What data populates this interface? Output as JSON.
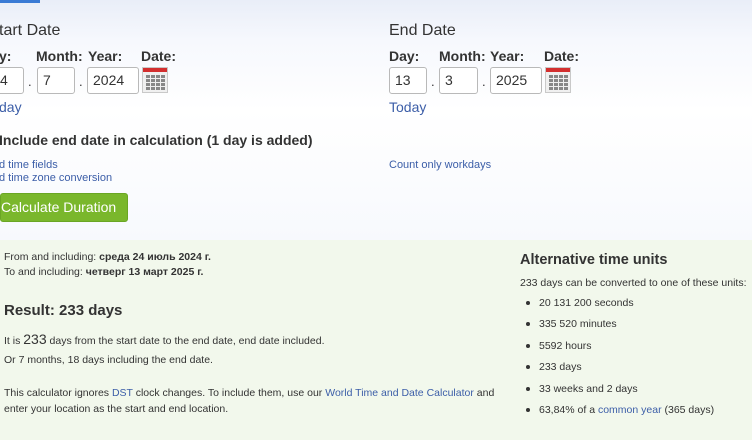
{
  "start": {
    "heading": "tart Date",
    "day_label": "y:",
    "month_label": "Month:",
    "year_label": "Year:",
    "date_label": "Date:",
    "day_value": "4",
    "month_value": "7",
    "year_value": "2024",
    "today_link": "day"
  },
  "end": {
    "heading": "End Date",
    "day_label": "Day:",
    "month_label": "Month:",
    "year_label": "Year:",
    "date_label": "Date:",
    "day_value": "13",
    "month_value": "3",
    "year_value": "2025",
    "today_link": "Today"
  },
  "options": {
    "include_end": "Include end date in calculation (1 day is added)",
    "add_time": "d time fields",
    "add_timezone": "d time zone conversion",
    "workdays": "Count only workdays"
  },
  "calculate_button": "Calculate Duration",
  "result": {
    "from_label": "From and including:",
    "from_value": "среда 24 июль 2024 г.",
    "to_label": "To and including:",
    "to_value": "четверг 13 март 2025 г.",
    "title": "Result: 233 days",
    "line1_a": "It is",
    "line1_num": "233",
    "line1_b": "days from the start date to the end date, end date included.",
    "line2": "Or 7 months, 18 days including the end date.",
    "note_a": "This calculator ignores",
    "note_dst": "DST",
    "note_b": "clock changes. To include them, use our",
    "note_link": "World Time and Date Calculator",
    "note_c": "and",
    "note_d": "enter your location as the start and end location."
  },
  "alt": {
    "title": "Alternative time units",
    "intro": "233 days can be converted to one of these units:",
    "items": [
      "20 131 200 seconds",
      "335 520 minutes",
      "5592 hours",
      "233 days",
      "33 weeks and 2 days"
    ],
    "last_a": "63,84% of a",
    "last_link": "common year",
    "last_b": "(365 days)"
  }
}
